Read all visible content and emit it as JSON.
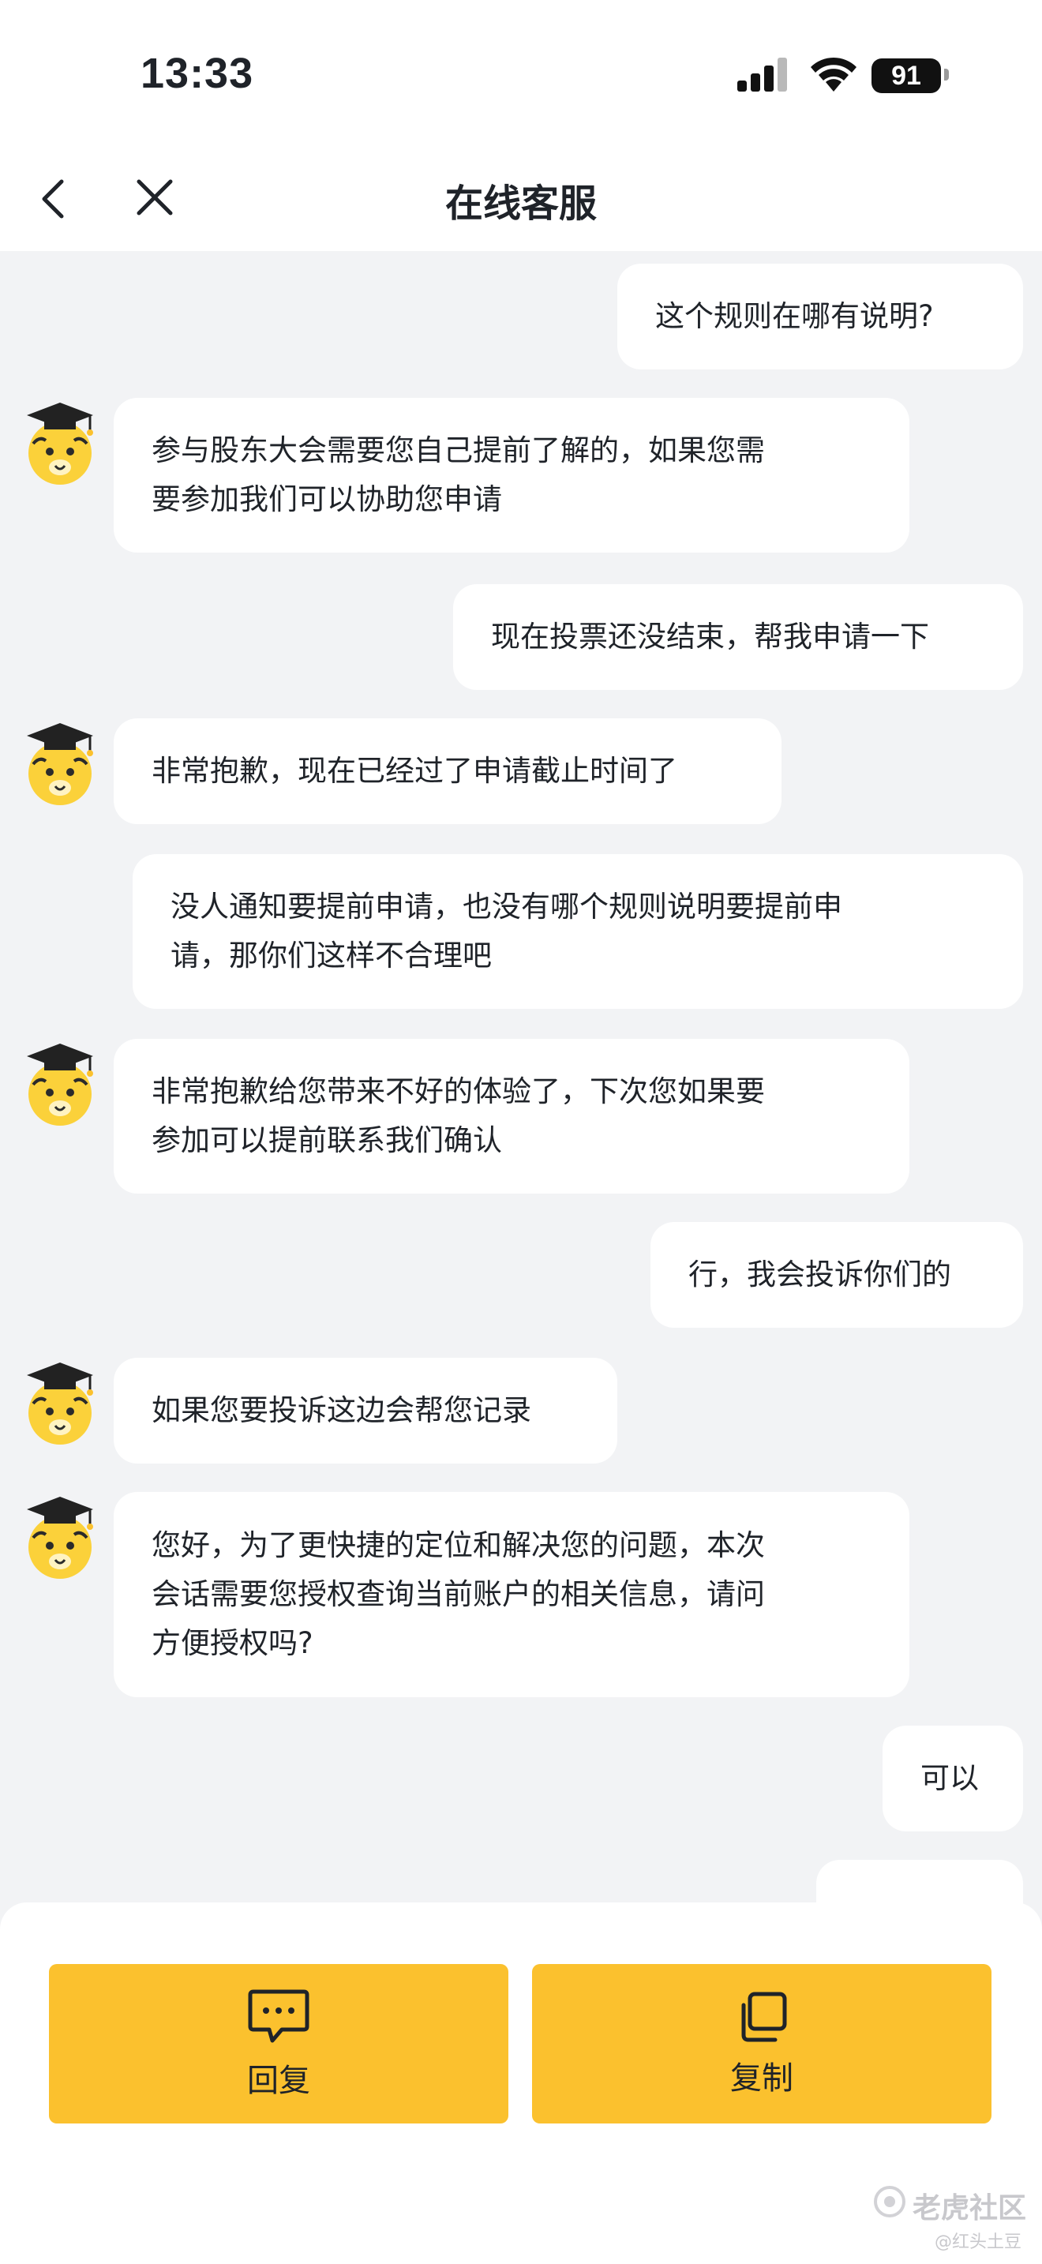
{
  "status": {
    "time": "13:33",
    "battery": "91"
  },
  "nav": {
    "title": "在线客服"
  },
  "messages": [
    {
      "side": "user",
      "text": "这个规则在哪有说明?"
    },
    {
      "side": "agent",
      "text": "参与股东大会需要您自己提前了解的，如果您需\n要参加我们可以协助您申请"
    },
    {
      "side": "user",
      "text": "现在投票还没结束，帮我申请一下"
    },
    {
      "side": "agent",
      "text": "非常抱歉，现在已经过了申请截止时间了"
    },
    {
      "side": "user",
      "text": "没人通知要提前申请，也没有哪个规则说明要提前申\n请，那你们这样不合理吧"
    },
    {
      "side": "agent",
      "text": "非常抱歉给您带来不好的体验了，下次您如果要\n参加可以提前联系我们确认"
    },
    {
      "side": "user",
      "text": "行，我会投诉你们的"
    },
    {
      "side": "agent",
      "text": "如果您要投诉这边会帮您记录"
    },
    {
      "side": "agent",
      "text": "您好，为了更快捷的定位和解决您的问题，本次\n会话需要您授权查询当前账户的相关信息，请问\n方便授权吗?"
    },
    {
      "side": "user",
      "text": "可以"
    }
  ],
  "actions": {
    "reply_label": "回复",
    "copy_label": "复制"
  },
  "watermark": {
    "brand": "老虎社区",
    "user": "@红头土豆"
  },
  "colors": {
    "accent": "#fbc12e",
    "background": "#f2f3f5",
    "bubble": "#ffffff"
  },
  "icons": [
    "back-arrow-icon",
    "close-icon",
    "tiger-avatar-icon",
    "chat-bubble-icon",
    "copy-icon"
  ]
}
